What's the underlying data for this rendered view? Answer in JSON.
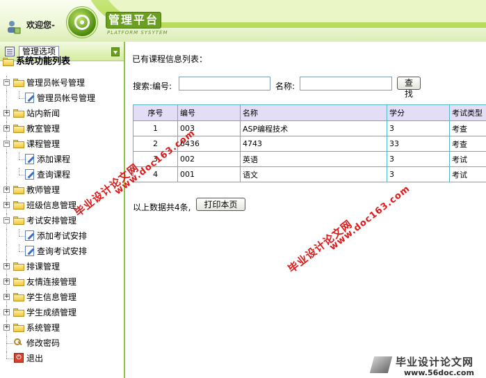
{
  "header": {
    "welcome": "欢迎您-",
    "platform_title": "管理平台",
    "platform_sub": "PLATFORM SYSYTEM"
  },
  "sidebar": {
    "title": "管理选项",
    "tree_root": "系统功能列表",
    "items": [
      {
        "label": "管理员帐号管理",
        "type": "folder",
        "state": "open"
      },
      {
        "label": "管理员帐号管理",
        "type": "leaf"
      },
      {
        "label": "站内新闻",
        "type": "folder",
        "state": "closed"
      },
      {
        "label": "教室管理",
        "type": "folder",
        "state": "closed"
      },
      {
        "label": "课程管理",
        "type": "folder",
        "state": "open"
      },
      {
        "label": "添加课程",
        "type": "leaf"
      },
      {
        "label": "查询课程",
        "type": "leaf"
      },
      {
        "label": "教师管理",
        "type": "folder",
        "state": "closed"
      },
      {
        "label": "班级信息管理",
        "type": "folder",
        "state": "closed"
      },
      {
        "label": "考试安排管理",
        "type": "folder",
        "state": "open"
      },
      {
        "label": "添加考试安排",
        "type": "leaf"
      },
      {
        "label": "查询考试安排",
        "type": "leaf"
      },
      {
        "label": "排课管理",
        "type": "folder",
        "state": "closed"
      },
      {
        "label": "友情连接管理",
        "type": "folder",
        "state": "closed"
      },
      {
        "label": "学生信息管理",
        "type": "folder",
        "state": "closed"
      },
      {
        "label": "学生成绩管理",
        "type": "folder",
        "state": "closed"
      },
      {
        "label": "系统管理",
        "type": "folder",
        "state": "closed"
      },
      {
        "label": "修改密码",
        "type": "key"
      },
      {
        "label": "退出",
        "type": "exit"
      }
    ]
  },
  "main": {
    "title": "已有课程信息列表：",
    "search": {
      "label": "搜索:编号:",
      "code_value": "",
      "name_label": "名称:",
      "name_value": "",
      "button": "查找"
    },
    "table": {
      "headers": [
        "序号",
        "编号",
        "名称",
        "学分",
        "考试类型"
      ],
      "rows": [
        [
          "1",
          "003",
          "ASP编程技术",
          "3",
          "考查"
        ],
        [
          "2",
          "6436",
          "4743",
          "33",
          "考查"
        ],
        [
          "3",
          "002",
          "英语",
          "3",
          "考试"
        ],
        [
          "4",
          "001",
          "语文",
          "3",
          "考试"
        ]
      ]
    },
    "summary": "以上数据共4条,",
    "print_button": "打印本页"
  },
  "watermarks": {
    "cn": "毕业设计论文网",
    "url": "www.doc163.com"
  },
  "footer_logo": {
    "cn": "毕业设计论文网",
    "url": "www.56doc.com"
  },
  "colors": {
    "accent_green": "#8cc63f",
    "table_border": "#4fb9c8",
    "table_header_bg": "#e3ddf6",
    "watermark_red": "#e01818"
  }
}
